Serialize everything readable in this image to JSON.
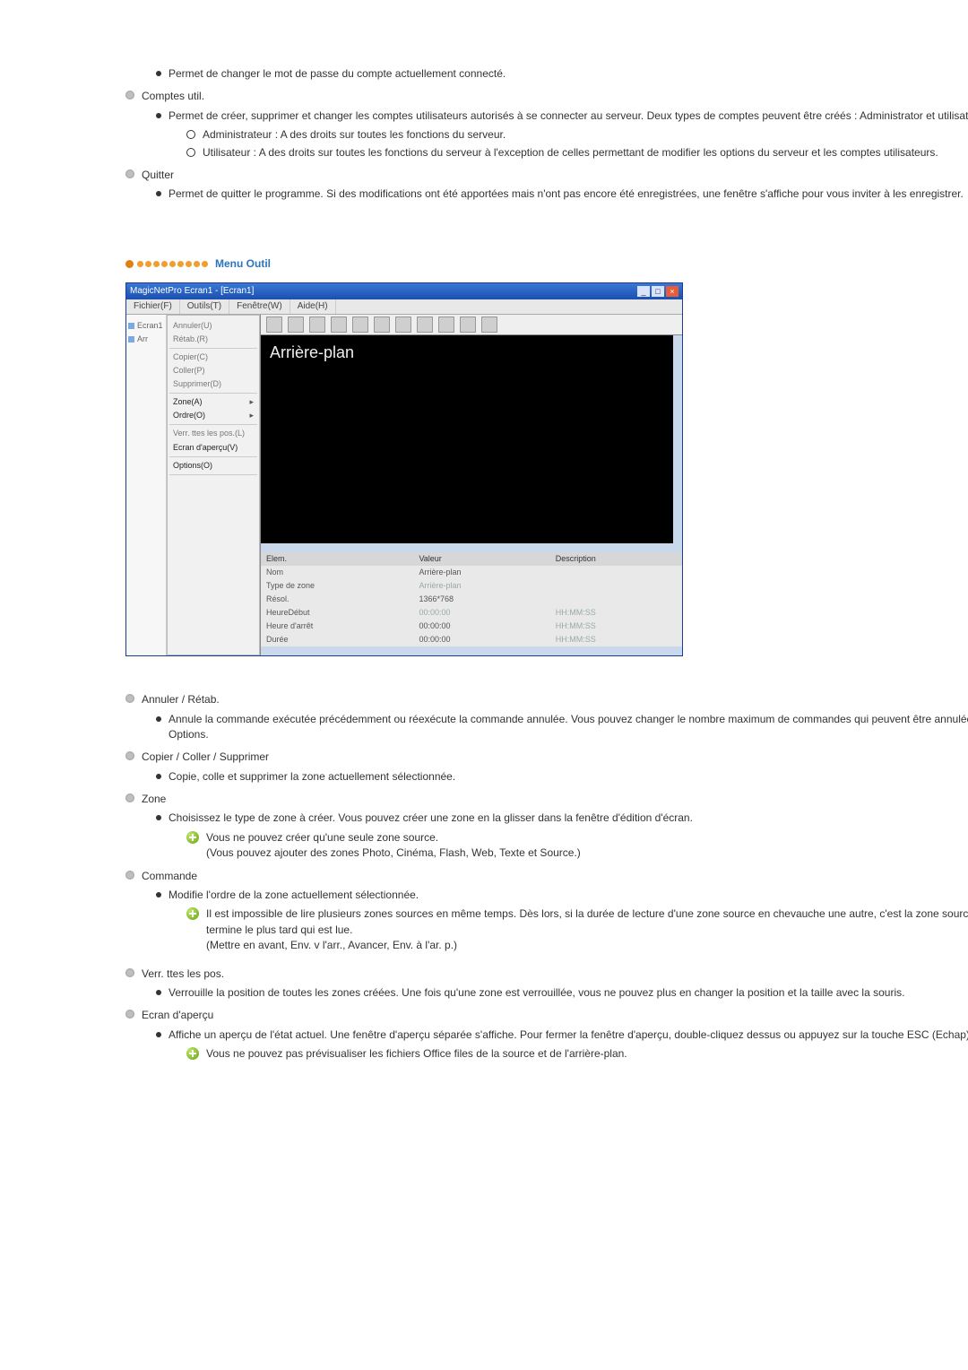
{
  "top_list": {
    "mdp_desc": "Permet de changer le mot de passe du compte actuellement connecté.",
    "comptes_label": "Comptes util.",
    "comptes_desc": "Permet de créer, supprimer et changer les comptes utilisateurs autorisés à se connecter au serveur. Deux types de comptes peuvent être créés : Administrator et utilisateur",
    "admin_desc": "Administrateur : A des droits sur toutes les fonctions du serveur.",
    "user_desc": "Utilisateur : A des droits sur toutes les fonctions du serveur à l'exception de celles permettant de modifier les options du serveur et les comptes utilisateurs.",
    "quitter_label": "Quitter",
    "quitter_desc": "Permet de quitter le programme. Si des modifications ont été apportées mais n'ont pas encore été enregistrées, une fenêtre s'affiche pour vous inviter à les enregistrer."
  },
  "section_title": "Menu Outil",
  "mnp": {
    "title": "MagicNetPro Ecran1 - [Ecran1]",
    "tabs": {
      "fichier": "Fichier(F)",
      "outils": "Outils(T)",
      "fenetre": "Fenêtre(W)",
      "aide": "Aide(H)"
    },
    "tree": {
      "n0": "Ecran1",
      "n1": "Arr"
    },
    "menu": {
      "annuler": "Annuler(U)",
      "retab": "Rétab.(R)",
      "copier": "Copier(C)",
      "coller": "Coller(P)",
      "supprimer": "Supprimer(D)",
      "zone": "Zone(A)",
      "ordre": "Ordre(O)",
      "verr": "Verr. ttes les pos.(L)",
      "apercu": "Ecran d'aperçu(V)",
      "options": "Options(O)"
    },
    "canvas_header": "Arrière-plan",
    "props": {
      "h0": "Elem.",
      "h1": "Valeur",
      "h2": "Description",
      "r0k": "Nom",
      "r0v": "Arrière-plan",
      "r1k": "Type de zone",
      "r1v": "Arrière-plan",
      "r2k": "Résol.",
      "r2v": "1366*768",
      "r3k": "HeureDébut",
      "r3v": "00:00:00",
      "r3d": "HH:MM:SS",
      "r4k": "Heure d'arrêt",
      "r4v": "00:00:00",
      "r4d": "HH:MM:SS",
      "r5k": "Durée",
      "r5v": "00:00:00",
      "r5d": "HH:MM:SS"
    }
  },
  "bottom_list": {
    "annuler_label": "Annuler / Rétab.",
    "annuler_desc": "Annule la commande exécutée précédemment ou réexécute la commande annulée. Vous pouvez changer le nombre maximum de commandes qui peuvent être annulées à l'aide du menu Options.",
    "ccs_label": "Copier / Coller / Supprimer",
    "ccs_desc": "Copie, colle et supprimer la zone actuellement sélectionnée.",
    "zone_label": "Zone",
    "zone_desc": "Choisissez le type de zone à créer. Vous pouvez créer une zone en la glisser dans la fenêtre d'édition d'écran.",
    "zone_note1": "Vous ne pouvez créer qu'une seule zone source.",
    "zone_note2": "(Vous pouvez ajouter des zones Photo, Cinéma, Flash, Web, Texte et Source.)",
    "cmd_label": "Commande",
    "cmd_desc": "Modifie l'ordre de la zone actuellement sélectionnée.",
    "cmd_note1": "Il est impossible de lire plusieurs zones sources en même temps. Dès lors, si la durée de lecture d'une zone source en chevauche une autre, c'est la zone source dont la lecture se termine le plus tard qui est lue.",
    "cmd_note2": "(Mettre en avant, Env. v l'arr., Avancer, Env. à l'ar. p.)",
    "ver_label": "Verr. ttes les pos.",
    "ver_desc": "Verrouille la position de toutes les zones créées. Une fois qu'une zone est verrouillée, vous ne pouvez plus en changer la position et la taille avec la souris.",
    "ap_label": "Ecran d'aperçu",
    "ap_desc": "Affiche un aperçu de l'état actuel. Une fenêtre d'aperçu séparée s'affiche. Pour fermer la fenêtre d'aperçu, double-cliquez dessus ou appuyez sur la touche ESC (Echap).",
    "ap_note": "Vous ne pouvez pas prévisualiser les fichiers Office files de la source et de l'arrière-plan."
  }
}
